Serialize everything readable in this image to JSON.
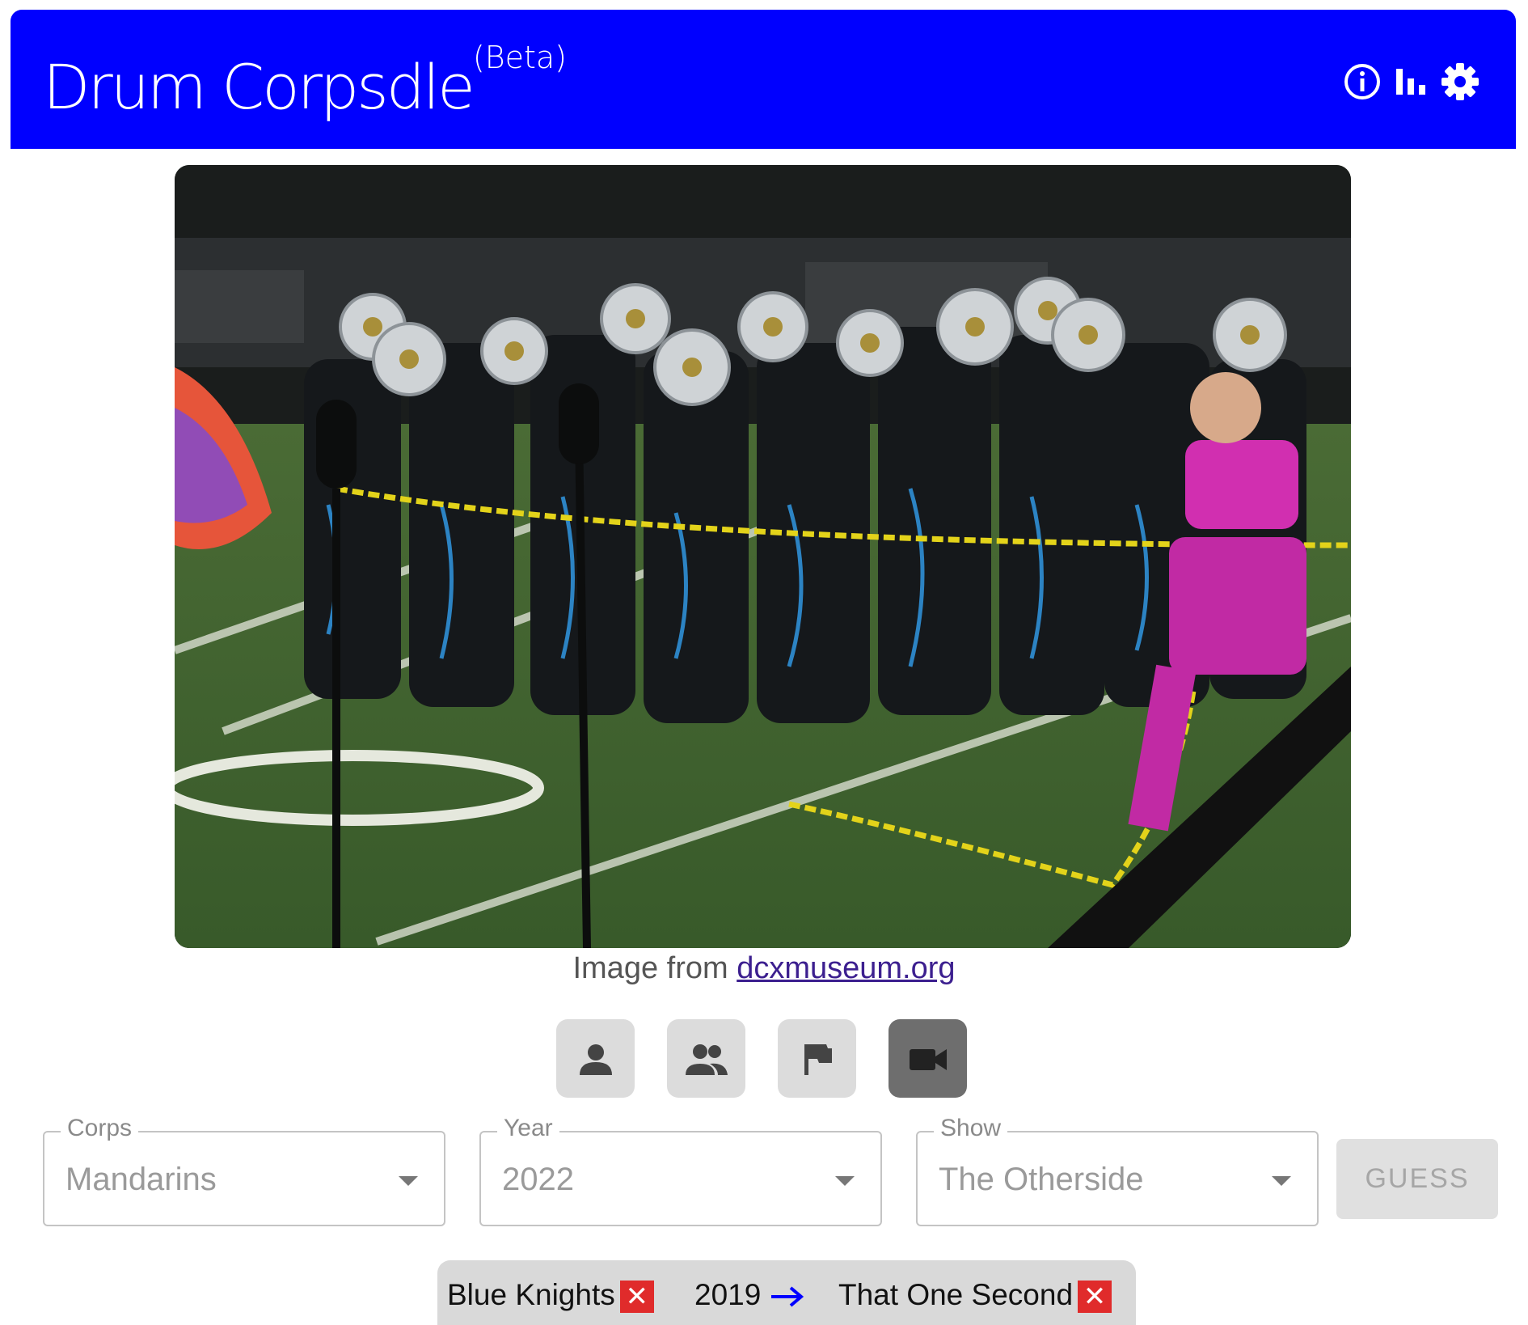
{
  "header": {
    "title": "Drum Corpsdle",
    "badge": "(Beta)",
    "icons": [
      "info-icon",
      "stats-icon",
      "settings-icon"
    ]
  },
  "image": {
    "credit_prefix": "Image from",
    "credit_link": "dcxmuseum.org"
  },
  "hints": [
    {
      "name": "person-icon",
      "active": false
    },
    {
      "name": "group-icon",
      "active": false
    },
    {
      "name": "flag-icon",
      "active": false
    },
    {
      "name": "video-icon",
      "active": true
    }
  ],
  "form": {
    "corps": {
      "label": "Corps",
      "value": "Mandarins"
    },
    "year": {
      "label": "Year",
      "value": "2022"
    },
    "show": {
      "label": "Show",
      "value": "The Otherside"
    },
    "guess_label": "GUESS"
  },
  "history": [
    {
      "corps": "Blue Knights",
      "corps_status": "wrong",
      "year": "2019",
      "year_hint": "later",
      "show": "That One Second",
      "show_status": "wrong"
    }
  ],
  "colors": {
    "brand": "#0000ff",
    "wrong": "#e02b2b",
    "arrow": "#0000ff"
  }
}
